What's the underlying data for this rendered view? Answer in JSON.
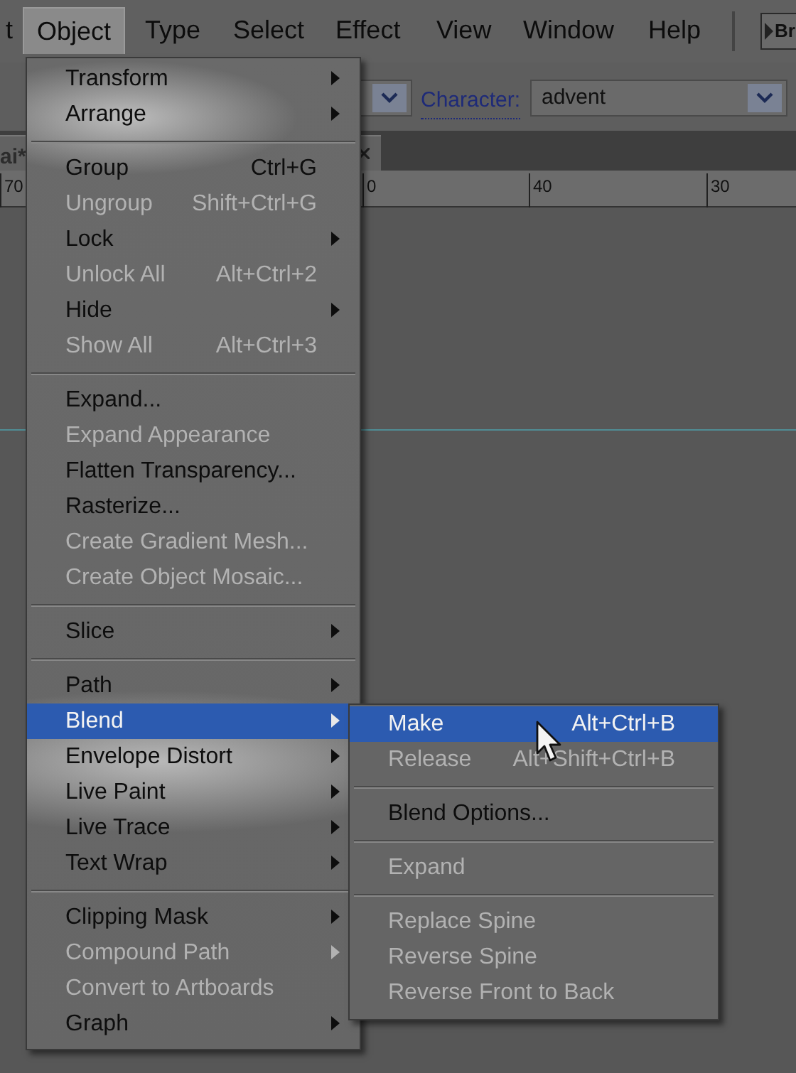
{
  "menubar": [
    {
      "label": "t",
      "selected": false
    },
    {
      "label": "Object",
      "selected": true
    },
    {
      "label": "Type",
      "selected": false
    },
    {
      "label": "Select",
      "selected": false
    },
    {
      "label": "Effect",
      "selected": false
    },
    {
      "label": "View",
      "selected": false
    },
    {
      "label": "Window",
      "selected": false
    },
    {
      "label": "Help",
      "selected": false
    }
  ],
  "bridge_button": {
    "label": "Br"
  },
  "toolbar": {
    "character_label": "Character:",
    "font_value": "advent"
  },
  "document_tab": {
    "label": "ai*"
  },
  "ruler": [
    "70",
    "0",
    "40",
    "30"
  ],
  "menu": [
    {
      "kind": "item",
      "label": "Transform",
      "submenu": true,
      "disabled": false,
      "selected": false
    },
    {
      "kind": "item",
      "label": "Arrange",
      "submenu": true,
      "disabled": false,
      "selected": false
    },
    {
      "kind": "separator"
    },
    {
      "kind": "item",
      "label": "Group",
      "shortcut": "Ctrl+G",
      "submenu": false,
      "disabled": false,
      "selected": false
    },
    {
      "kind": "item",
      "label": "Ungroup",
      "shortcut": "Shift+Ctrl+G",
      "submenu": false,
      "disabled": true,
      "selected": false
    },
    {
      "kind": "item",
      "label": "Lock",
      "submenu": true,
      "disabled": false,
      "selected": false
    },
    {
      "kind": "item",
      "label": "Unlock All",
      "shortcut": "Alt+Ctrl+2",
      "submenu": false,
      "disabled": true,
      "selected": false
    },
    {
      "kind": "item",
      "label": "Hide",
      "submenu": true,
      "disabled": false,
      "selected": false
    },
    {
      "kind": "item",
      "label": "Show All",
      "shortcut": "Alt+Ctrl+3",
      "submenu": false,
      "disabled": true,
      "selected": false
    },
    {
      "kind": "separator"
    },
    {
      "kind": "item",
      "label": "Expand...",
      "submenu": false,
      "disabled": false,
      "selected": false
    },
    {
      "kind": "item",
      "label": "Expand Appearance",
      "submenu": false,
      "disabled": true,
      "selected": false
    },
    {
      "kind": "item",
      "label": "Flatten Transparency...",
      "submenu": false,
      "disabled": false,
      "selected": false
    },
    {
      "kind": "item",
      "label": "Rasterize...",
      "submenu": false,
      "disabled": false,
      "selected": false
    },
    {
      "kind": "item",
      "label": "Create Gradient Mesh...",
      "submenu": false,
      "disabled": true,
      "selected": false
    },
    {
      "kind": "item",
      "label": "Create Object Mosaic...",
      "submenu": false,
      "disabled": true,
      "selected": false
    },
    {
      "kind": "separator"
    },
    {
      "kind": "item",
      "label": "Slice",
      "submenu": true,
      "disabled": false,
      "selected": false
    },
    {
      "kind": "separator"
    },
    {
      "kind": "item",
      "label": "Path",
      "submenu": true,
      "disabled": false,
      "selected": false
    },
    {
      "kind": "item",
      "label": "Blend",
      "submenu": true,
      "disabled": false,
      "selected": true
    },
    {
      "kind": "item",
      "label": "Envelope Distort",
      "submenu": true,
      "disabled": false,
      "selected": false
    },
    {
      "kind": "item",
      "label": "Live Paint",
      "submenu": true,
      "disabled": false,
      "selected": false
    },
    {
      "kind": "item",
      "label": "Live Trace",
      "submenu": true,
      "disabled": false,
      "selected": false
    },
    {
      "kind": "item",
      "label": "Text Wrap",
      "submenu": true,
      "disabled": false,
      "selected": false
    },
    {
      "kind": "separator"
    },
    {
      "kind": "item",
      "label": "Clipping Mask",
      "submenu": true,
      "disabled": false,
      "selected": false
    },
    {
      "kind": "item",
      "label": "Compound Path",
      "submenu": true,
      "disabled": true,
      "selected": false
    },
    {
      "kind": "item",
      "label": "Convert to Artboards",
      "submenu": false,
      "disabled": true,
      "selected": false
    },
    {
      "kind": "item",
      "label": "Graph",
      "submenu": true,
      "disabled": false,
      "selected": false
    }
  ],
  "submenu": [
    {
      "kind": "item",
      "label": "Make",
      "shortcut": "Alt+Ctrl+B",
      "disabled": false,
      "selected": true
    },
    {
      "kind": "item",
      "label": "Release",
      "shortcut": "Alt+Shift+Ctrl+B",
      "disabled": true,
      "selected": false
    },
    {
      "kind": "separator"
    },
    {
      "kind": "item",
      "label": "Blend Options...",
      "disabled": false,
      "selected": false
    },
    {
      "kind": "separator"
    },
    {
      "kind": "item",
      "label": "Expand",
      "disabled": true,
      "selected": false
    },
    {
      "kind": "separator"
    },
    {
      "kind": "item",
      "label": "Replace Spine",
      "disabled": true,
      "selected": false
    },
    {
      "kind": "item",
      "label": "Reverse Spine",
      "disabled": true,
      "selected": false
    },
    {
      "kind": "item",
      "label": "Reverse Front to Back",
      "disabled": true,
      "selected": false
    }
  ]
}
